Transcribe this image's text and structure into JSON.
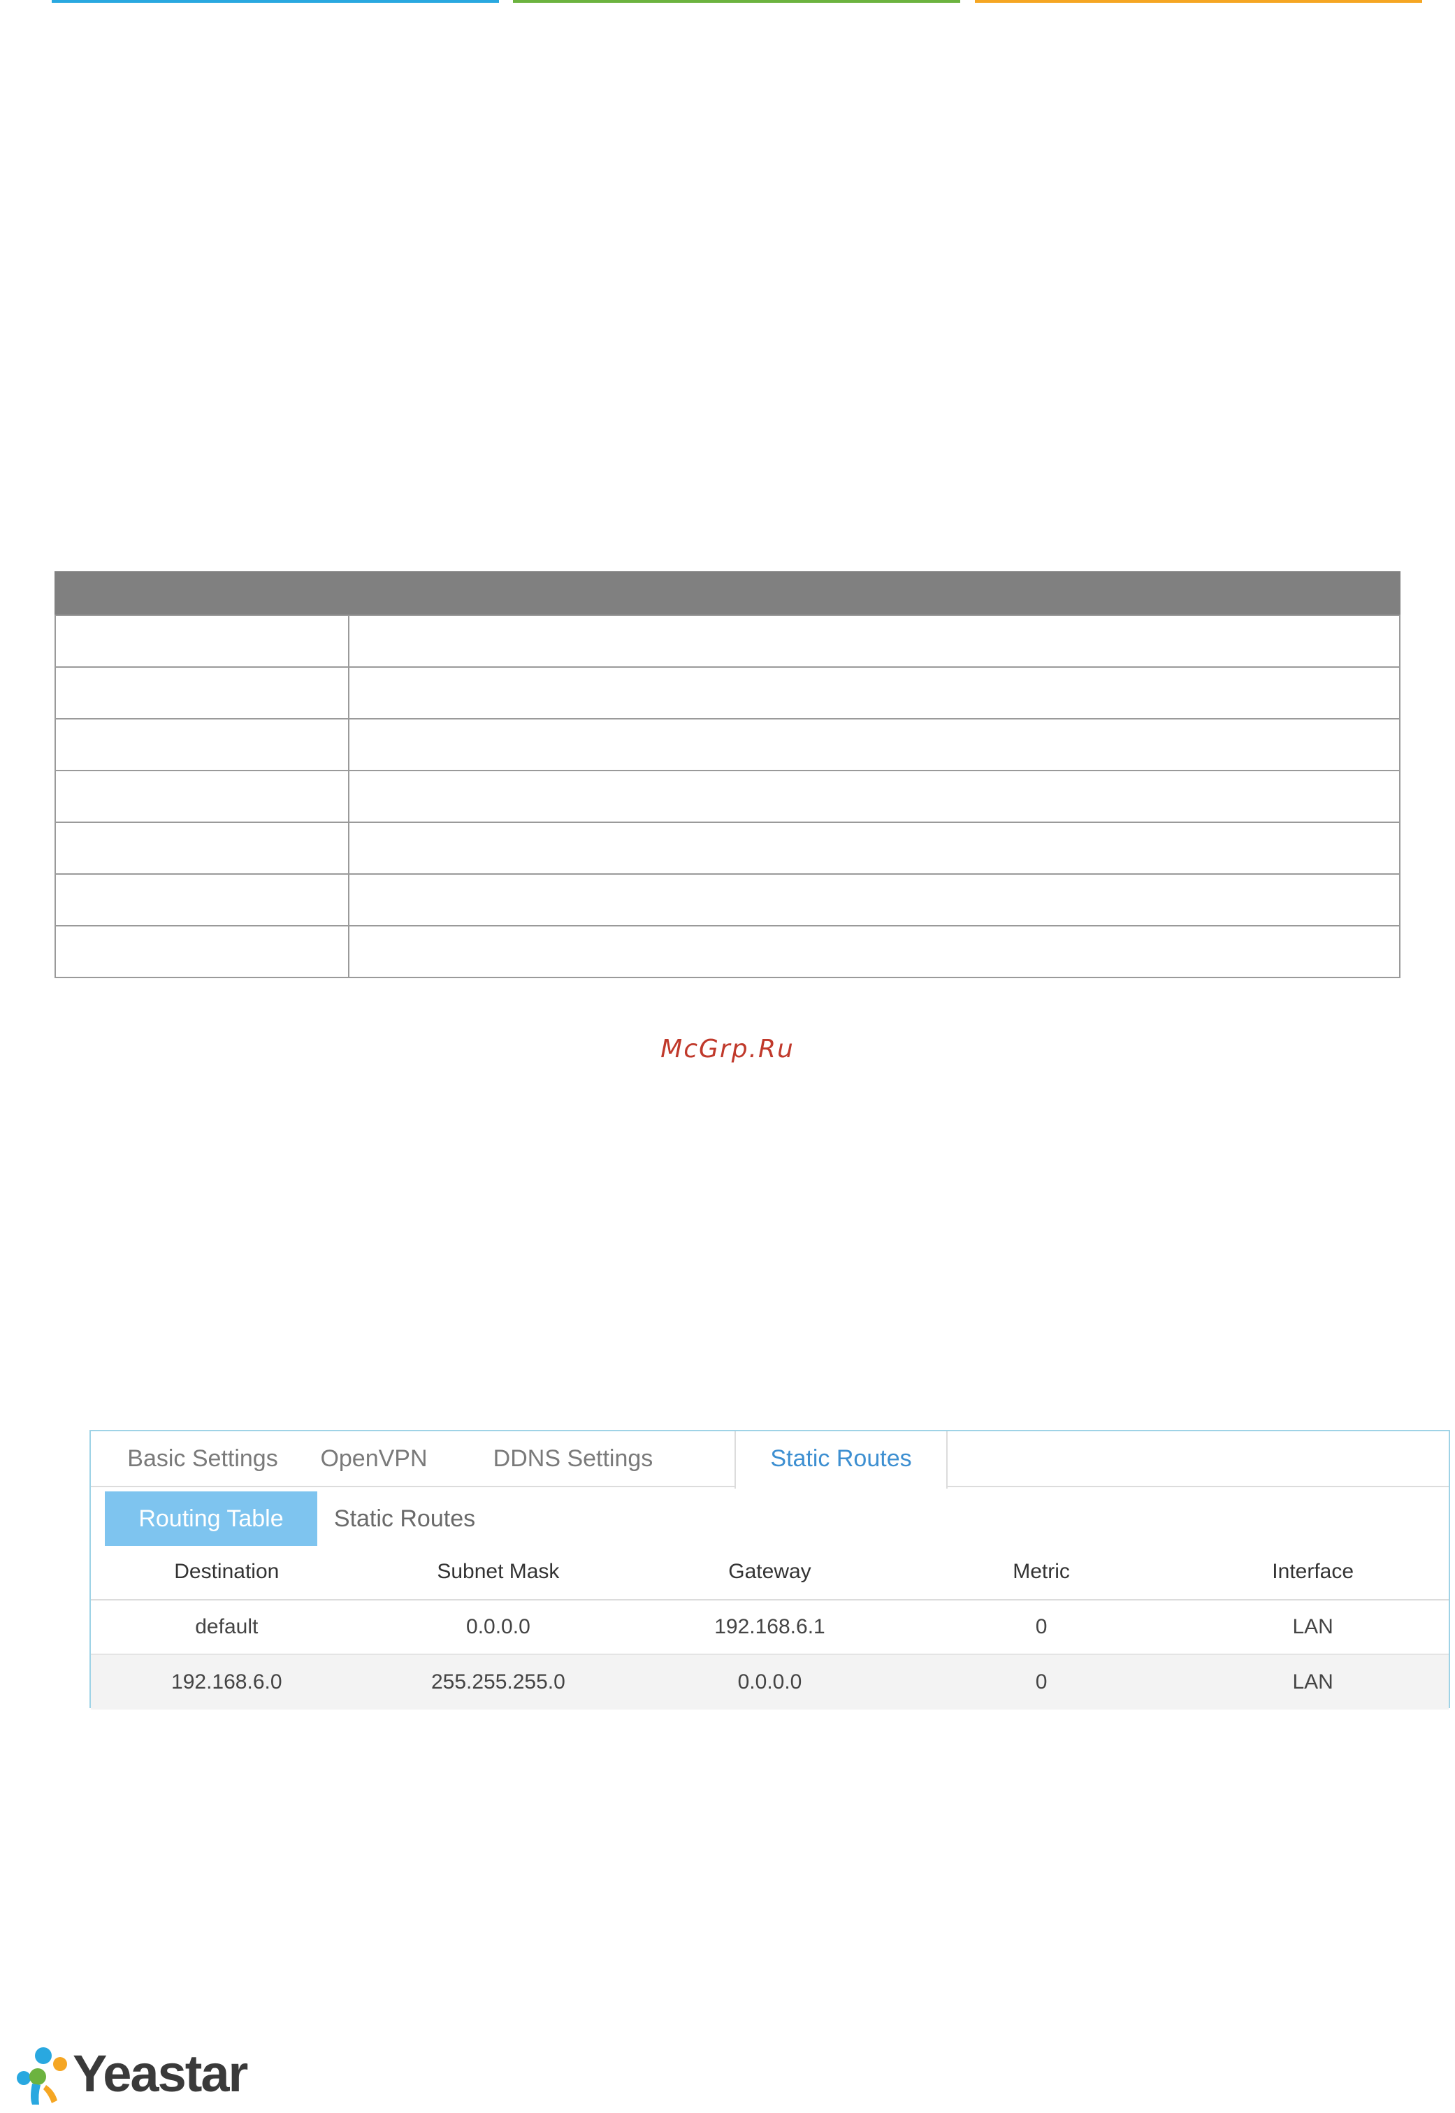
{
  "colors": {
    "top_bar_1": "#29a8e0",
    "top_bar_2": "#6cb33f",
    "top_bar_3": "#f5a623",
    "watermark": "#c0392b",
    "active_tab_text": "#3d8fd1",
    "active_subtab_bg": "#7ec4ef"
  },
  "watermark": "McGrp.Ru",
  "tabs": [
    {
      "label": "Basic Settings"
    },
    {
      "label": "OpenVPN"
    },
    {
      "label": "DDNS Settings"
    },
    {
      "label": "Static Routes",
      "active": true
    }
  ],
  "subtabs": [
    {
      "label": "Routing Table",
      "active": true
    },
    {
      "label": "Static Routes"
    }
  ],
  "routing_table": {
    "columns": [
      "Destination",
      "Subnet Mask",
      "Gateway",
      "Metric",
      "Interface"
    ],
    "rows": [
      [
        "default",
        "0.0.0.0",
        "192.168.6.1",
        "0",
        "LAN"
      ],
      [
        "192.168.6.0",
        "255.255.255.0",
        "0.0.0.0",
        "0",
        "LAN"
      ]
    ]
  },
  "logo": {
    "text": "Yeastar"
  }
}
